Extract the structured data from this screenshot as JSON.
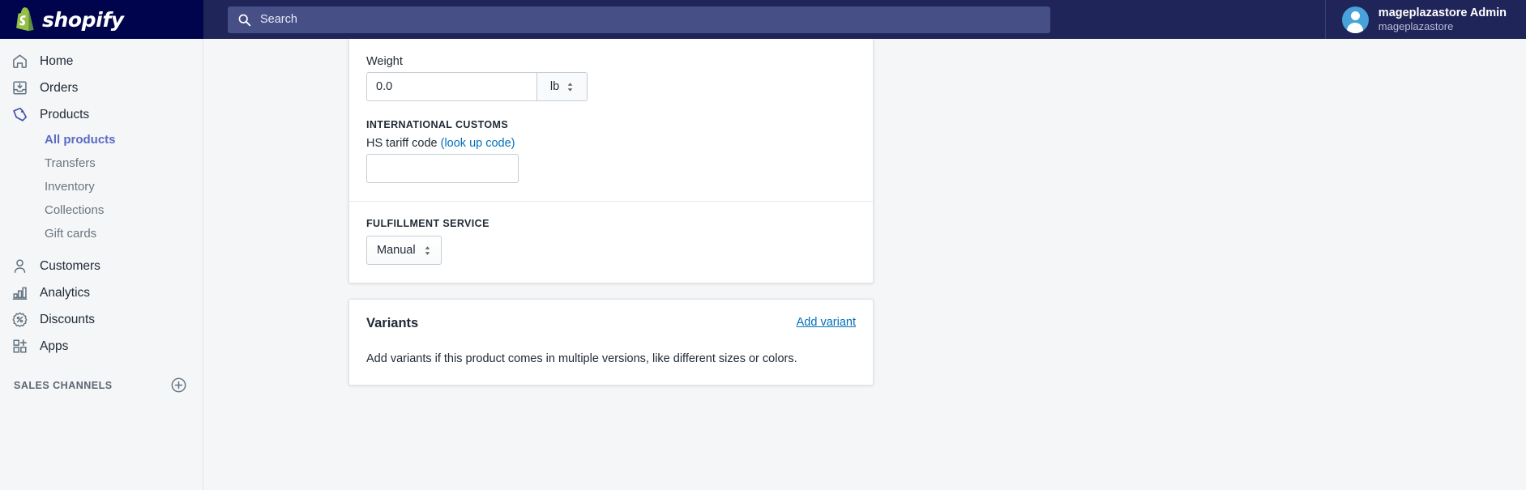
{
  "topbar": {
    "brand_name": "shopify",
    "brand_icon": "shopify-bag-logo",
    "search": {
      "placeholder": "Search",
      "value": "",
      "icon": "search-icon"
    },
    "user": {
      "name": "mageplazastore Admin",
      "store": "mageplazastore",
      "avatar_icon": "user-avatar-icon"
    },
    "colors": {
      "brand_bg": "#00044c",
      "bar_bg": "#1f2459",
      "search_bg": "#474f87"
    }
  },
  "sidebar": {
    "items": [
      {
        "label": "Home",
        "icon": "home-icon",
        "active": false
      },
      {
        "label": "Orders",
        "icon": "orders-inbox-icon",
        "active": false
      },
      {
        "label": "Products",
        "icon": "products-tag-icon",
        "active": true
      }
    ],
    "sub_items": [
      {
        "label": "All products",
        "selected": true
      },
      {
        "label": "Transfers",
        "selected": false
      },
      {
        "label": "Inventory",
        "selected": false
      },
      {
        "label": "Collections",
        "selected": false
      },
      {
        "label": "Gift cards",
        "selected": false
      }
    ],
    "items_lower": [
      {
        "label": "Customers",
        "icon": "customer-person-icon"
      },
      {
        "label": "Analytics",
        "icon": "analytics-bars-icon"
      },
      {
        "label": "Discounts",
        "icon": "discount-percent-icon"
      },
      {
        "label": "Apps",
        "icon": "apps-grid-plus-icon"
      }
    ],
    "section": {
      "title": "SALES CHANNELS",
      "add_icon": "plus-circle-icon"
    },
    "colors": {
      "active_link": "#5c6ac4",
      "muted_link": "#6b7680"
    }
  },
  "main": {
    "shipping_card": {
      "weight": {
        "label": "Weight",
        "value": "0.0",
        "unit": "lb",
        "unit_stepper_icon": "chevron-up-down-icon"
      },
      "international_customs": {
        "heading": "INTERNATIONAL CUSTOMS",
        "hs_label": "HS tariff code",
        "hs_link": "(look up code)",
        "hs_value": "",
        "hs_placeholder": ""
      },
      "fulfillment": {
        "heading": "FULFILLMENT SERVICE",
        "selected": "Manual",
        "stepper_icon": "chevron-up-down-icon"
      }
    },
    "variants_card": {
      "title": "Variants",
      "add_link": "Add variant",
      "description": "Add variants if this product comes in multiple versions, like different sizes or colors."
    }
  }
}
